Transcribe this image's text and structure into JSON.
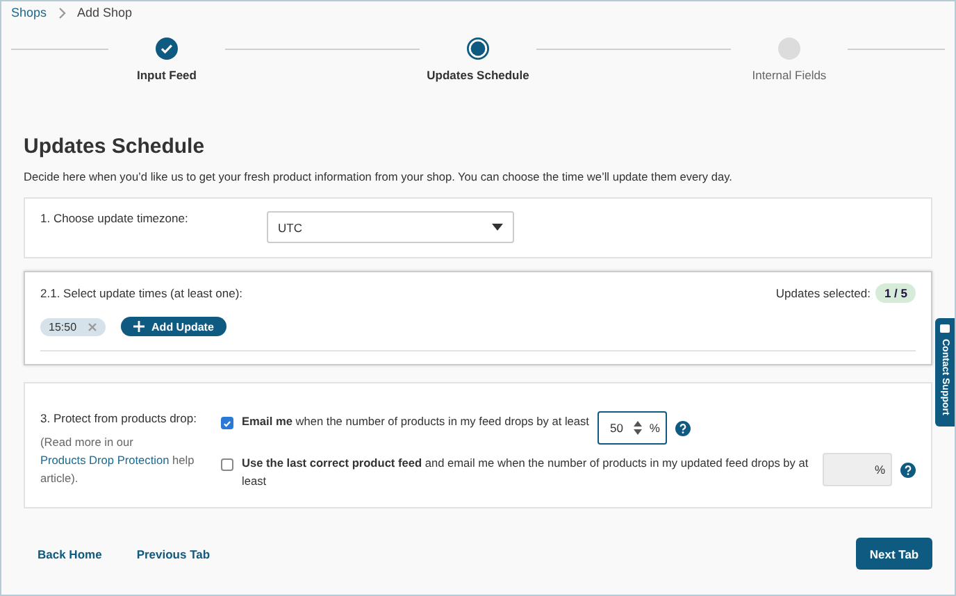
{
  "breadcrumb": [
    {
      "label": "Shops",
      "kind": "link"
    },
    {
      "label": "Add Shop",
      "kind": "current"
    }
  ],
  "steps": [
    {
      "label": "Input Feed",
      "kind": "done"
    },
    {
      "label": "Updates Schedule",
      "kind": "current"
    },
    {
      "label": "Internal Fields",
      "kind": "pending"
    }
  ],
  "heading": "Updates Schedule",
  "description": "Decide here when you’d like us to get your fresh product information from your shop. You can choose the time we’ll update them every day.",
  "timezone": {
    "label": "1. Choose update timezone:",
    "value": "UTC"
  },
  "update_times": {
    "label": "2.1. Select update times (at least one):",
    "counter_label": "Updates selected:",
    "counter": "1 / 5",
    "times": [
      "15:50"
    ],
    "add_button": "Add Update"
  },
  "protection": {
    "label": "3. Protect from products drop:",
    "help_before": "(Read more in our ",
    "help_link": "Products Drop Protection",
    "help_after": " help article).",
    "options": [
      {
        "text": "**Email me** when the number of products in my feed drops by at least",
        "checked": true,
        "value": "50",
        "unit": "%",
        "disabled": false
      },
      {
        "text": "**Use the last correct product feed** and email me when the number of products in my updated feed drops by at least",
        "checked": false,
        "unit": "%",
        "disabled": true
      }
    ]
  },
  "footer": {
    "links": [
      "Back Home",
      "Previous Tab"
    ],
    "next_button": "Next Tab"
  },
  "contact_tab": "Contact Support"
}
